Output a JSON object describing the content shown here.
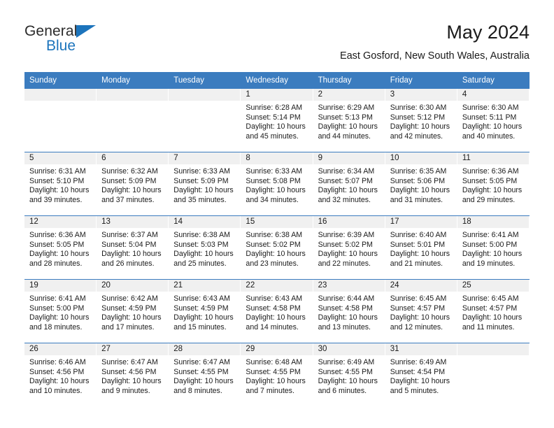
{
  "brand": {
    "name_part1": "General",
    "name_part2": "Blue",
    "triangle_color": "#1c74bc"
  },
  "header": {
    "title": "May 2024",
    "subtitle": "East Gosford, New South Wales, Australia"
  },
  "theme": {
    "header_blue": "#3b7cbf",
    "day_band_gray": "#f0f0f0"
  },
  "weekdays": [
    "Sunday",
    "Monday",
    "Tuesday",
    "Wednesday",
    "Thursday",
    "Friday",
    "Saturday"
  ],
  "weeks": [
    [
      {
        "day": "",
        "empty": true
      },
      {
        "day": "",
        "empty": true
      },
      {
        "day": "",
        "empty": true
      },
      {
        "day": "1",
        "sunrise": "Sunrise: 6:28 AM",
        "sunset": "Sunset: 5:14 PM",
        "daylight_line1": "Daylight: 10 hours",
        "daylight_line2": "and 45 minutes."
      },
      {
        "day": "2",
        "sunrise": "Sunrise: 6:29 AM",
        "sunset": "Sunset: 5:13 PM",
        "daylight_line1": "Daylight: 10 hours",
        "daylight_line2": "and 44 minutes."
      },
      {
        "day": "3",
        "sunrise": "Sunrise: 6:30 AM",
        "sunset": "Sunset: 5:12 PM",
        "daylight_line1": "Daylight: 10 hours",
        "daylight_line2": "and 42 minutes."
      },
      {
        "day": "4",
        "sunrise": "Sunrise: 6:30 AM",
        "sunset": "Sunset: 5:11 PM",
        "daylight_line1": "Daylight: 10 hours",
        "daylight_line2": "and 40 minutes."
      }
    ],
    [
      {
        "day": "5",
        "sunrise": "Sunrise: 6:31 AM",
        "sunset": "Sunset: 5:10 PM",
        "daylight_line1": "Daylight: 10 hours",
        "daylight_line2": "and 39 minutes."
      },
      {
        "day": "6",
        "sunrise": "Sunrise: 6:32 AM",
        "sunset": "Sunset: 5:09 PM",
        "daylight_line1": "Daylight: 10 hours",
        "daylight_line2": "and 37 minutes."
      },
      {
        "day": "7",
        "sunrise": "Sunrise: 6:33 AM",
        "sunset": "Sunset: 5:09 PM",
        "daylight_line1": "Daylight: 10 hours",
        "daylight_line2": "and 35 minutes."
      },
      {
        "day": "8",
        "sunrise": "Sunrise: 6:33 AM",
        "sunset": "Sunset: 5:08 PM",
        "daylight_line1": "Daylight: 10 hours",
        "daylight_line2": "and 34 minutes."
      },
      {
        "day": "9",
        "sunrise": "Sunrise: 6:34 AM",
        "sunset": "Sunset: 5:07 PM",
        "daylight_line1": "Daylight: 10 hours",
        "daylight_line2": "and 32 minutes."
      },
      {
        "day": "10",
        "sunrise": "Sunrise: 6:35 AM",
        "sunset": "Sunset: 5:06 PM",
        "daylight_line1": "Daylight: 10 hours",
        "daylight_line2": "and 31 minutes."
      },
      {
        "day": "11",
        "sunrise": "Sunrise: 6:36 AM",
        "sunset": "Sunset: 5:05 PM",
        "daylight_line1": "Daylight: 10 hours",
        "daylight_line2": "and 29 minutes."
      }
    ],
    [
      {
        "day": "12",
        "sunrise": "Sunrise: 6:36 AM",
        "sunset": "Sunset: 5:05 PM",
        "daylight_line1": "Daylight: 10 hours",
        "daylight_line2": "and 28 minutes."
      },
      {
        "day": "13",
        "sunrise": "Sunrise: 6:37 AM",
        "sunset": "Sunset: 5:04 PM",
        "daylight_line1": "Daylight: 10 hours",
        "daylight_line2": "and 26 minutes."
      },
      {
        "day": "14",
        "sunrise": "Sunrise: 6:38 AM",
        "sunset": "Sunset: 5:03 PM",
        "daylight_line1": "Daylight: 10 hours",
        "daylight_line2": "and 25 minutes."
      },
      {
        "day": "15",
        "sunrise": "Sunrise: 6:38 AM",
        "sunset": "Sunset: 5:02 PM",
        "daylight_line1": "Daylight: 10 hours",
        "daylight_line2": "and 23 minutes."
      },
      {
        "day": "16",
        "sunrise": "Sunrise: 6:39 AM",
        "sunset": "Sunset: 5:02 PM",
        "daylight_line1": "Daylight: 10 hours",
        "daylight_line2": "and 22 minutes."
      },
      {
        "day": "17",
        "sunrise": "Sunrise: 6:40 AM",
        "sunset": "Sunset: 5:01 PM",
        "daylight_line1": "Daylight: 10 hours",
        "daylight_line2": "and 21 minutes."
      },
      {
        "day": "18",
        "sunrise": "Sunrise: 6:41 AM",
        "sunset": "Sunset: 5:00 PM",
        "daylight_line1": "Daylight: 10 hours",
        "daylight_line2": "and 19 minutes."
      }
    ],
    [
      {
        "day": "19",
        "sunrise": "Sunrise: 6:41 AM",
        "sunset": "Sunset: 5:00 PM",
        "daylight_line1": "Daylight: 10 hours",
        "daylight_line2": "and 18 minutes."
      },
      {
        "day": "20",
        "sunrise": "Sunrise: 6:42 AM",
        "sunset": "Sunset: 4:59 PM",
        "daylight_line1": "Daylight: 10 hours",
        "daylight_line2": "and 17 minutes."
      },
      {
        "day": "21",
        "sunrise": "Sunrise: 6:43 AM",
        "sunset": "Sunset: 4:59 PM",
        "daylight_line1": "Daylight: 10 hours",
        "daylight_line2": "and 15 minutes."
      },
      {
        "day": "22",
        "sunrise": "Sunrise: 6:43 AM",
        "sunset": "Sunset: 4:58 PM",
        "daylight_line1": "Daylight: 10 hours",
        "daylight_line2": "and 14 minutes."
      },
      {
        "day": "23",
        "sunrise": "Sunrise: 6:44 AM",
        "sunset": "Sunset: 4:58 PM",
        "daylight_line1": "Daylight: 10 hours",
        "daylight_line2": "and 13 minutes."
      },
      {
        "day": "24",
        "sunrise": "Sunrise: 6:45 AM",
        "sunset": "Sunset: 4:57 PM",
        "daylight_line1": "Daylight: 10 hours",
        "daylight_line2": "and 12 minutes."
      },
      {
        "day": "25",
        "sunrise": "Sunrise: 6:45 AM",
        "sunset": "Sunset: 4:57 PM",
        "daylight_line1": "Daylight: 10 hours",
        "daylight_line2": "and 11 minutes."
      }
    ],
    [
      {
        "day": "26",
        "sunrise": "Sunrise: 6:46 AM",
        "sunset": "Sunset: 4:56 PM",
        "daylight_line1": "Daylight: 10 hours",
        "daylight_line2": "and 10 minutes."
      },
      {
        "day": "27",
        "sunrise": "Sunrise: 6:47 AM",
        "sunset": "Sunset: 4:56 PM",
        "daylight_line1": "Daylight: 10 hours",
        "daylight_line2": "and 9 minutes."
      },
      {
        "day": "28",
        "sunrise": "Sunrise: 6:47 AM",
        "sunset": "Sunset: 4:55 PM",
        "daylight_line1": "Daylight: 10 hours",
        "daylight_line2": "and 8 minutes."
      },
      {
        "day": "29",
        "sunrise": "Sunrise: 6:48 AM",
        "sunset": "Sunset: 4:55 PM",
        "daylight_line1": "Daylight: 10 hours",
        "daylight_line2": "and 7 minutes."
      },
      {
        "day": "30",
        "sunrise": "Sunrise: 6:49 AM",
        "sunset": "Sunset: 4:55 PM",
        "daylight_line1": "Daylight: 10 hours",
        "daylight_line2": "and 6 minutes."
      },
      {
        "day": "31",
        "sunrise": "Sunrise: 6:49 AM",
        "sunset": "Sunset: 4:54 PM",
        "daylight_line1": "Daylight: 10 hours",
        "daylight_line2": "and 5 minutes."
      },
      {
        "day": "",
        "empty": true
      }
    ]
  ]
}
